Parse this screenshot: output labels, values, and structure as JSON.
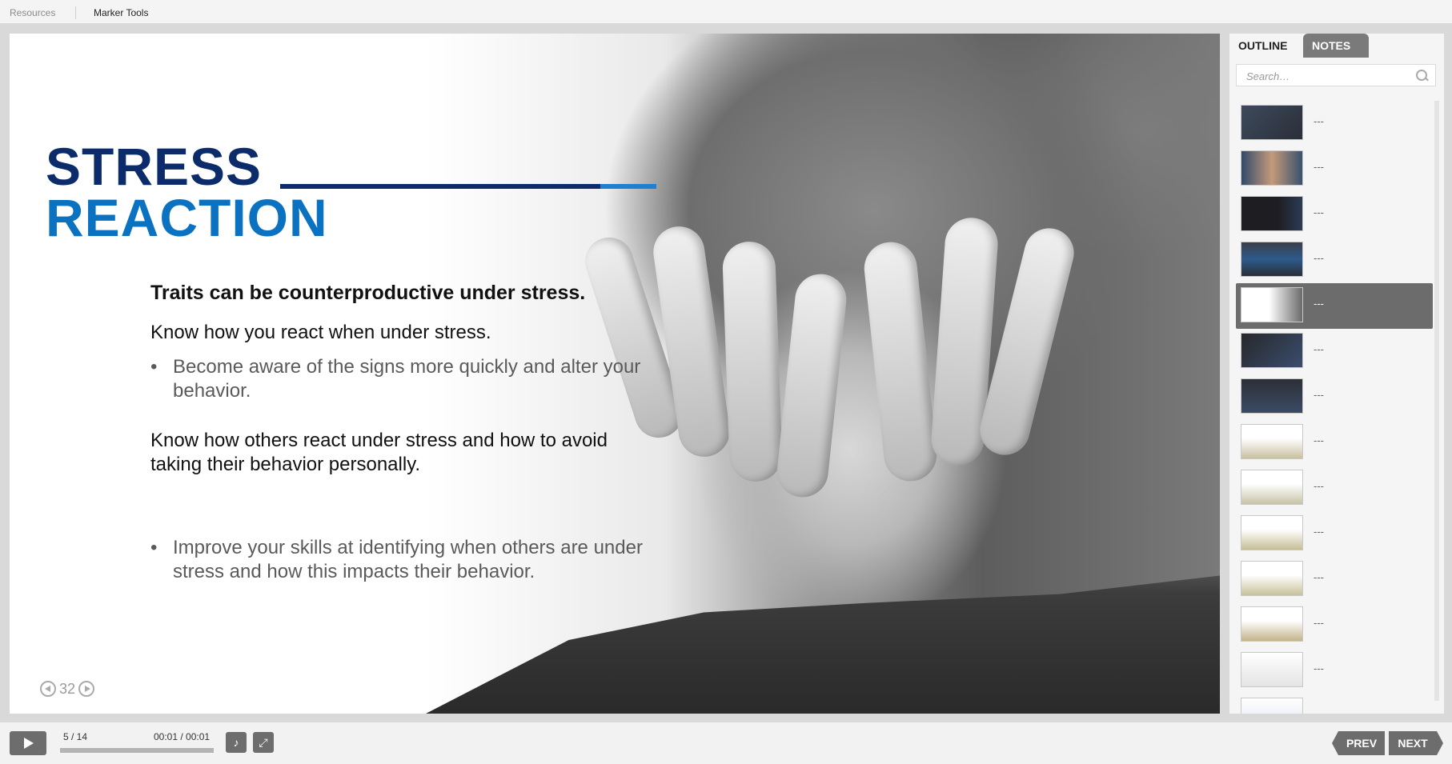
{
  "topbar": {
    "resources": "Resources",
    "marker_tools": "Marker Tools"
  },
  "slide": {
    "title_line1": "STRESS",
    "title_line2": "REACTION",
    "heading": "Traits can be counterproductive under stress.",
    "para1": "Know how you react when under stress.",
    "bullet1": "Become aware of the signs more quickly and alter your behavior.",
    "para2": "Know how others react under stress and how to avoid taking their behavior personally.",
    "bullet2": "Improve your skills at identifying when others are under stress and how this impacts their behavior.",
    "page_number": "32",
    "colors": {
      "title_dark": "#0c2b6b",
      "title_light": "#0a72c0"
    }
  },
  "sidebar": {
    "tab_outline": "OUTLINE",
    "tab_notes": "NOTES",
    "search_placeholder": "Search…",
    "items": [
      {
        "label": "---"
      },
      {
        "label": "---"
      },
      {
        "label": "---"
      },
      {
        "label": "---"
      },
      {
        "label": "---"
      },
      {
        "label": "---"
      },
      {
        "label": "---"
      },
      {
        "label": "---"
      },
      {
        "label": "---"
      },
      {
        "label": "---"
      },
      {
        "label": "---"
      },
      {
        "label": "---"
      },
      {
        "label": "---"
      },
      {
        "label": ""
      }
    ],
    "active_index": 4
  },
  "player": {
    "slide_count": "5 / 14",
    "time": "00:01 / 00:01",
    "prev": "PREV",
    "next": "NEXT"
  }
}
